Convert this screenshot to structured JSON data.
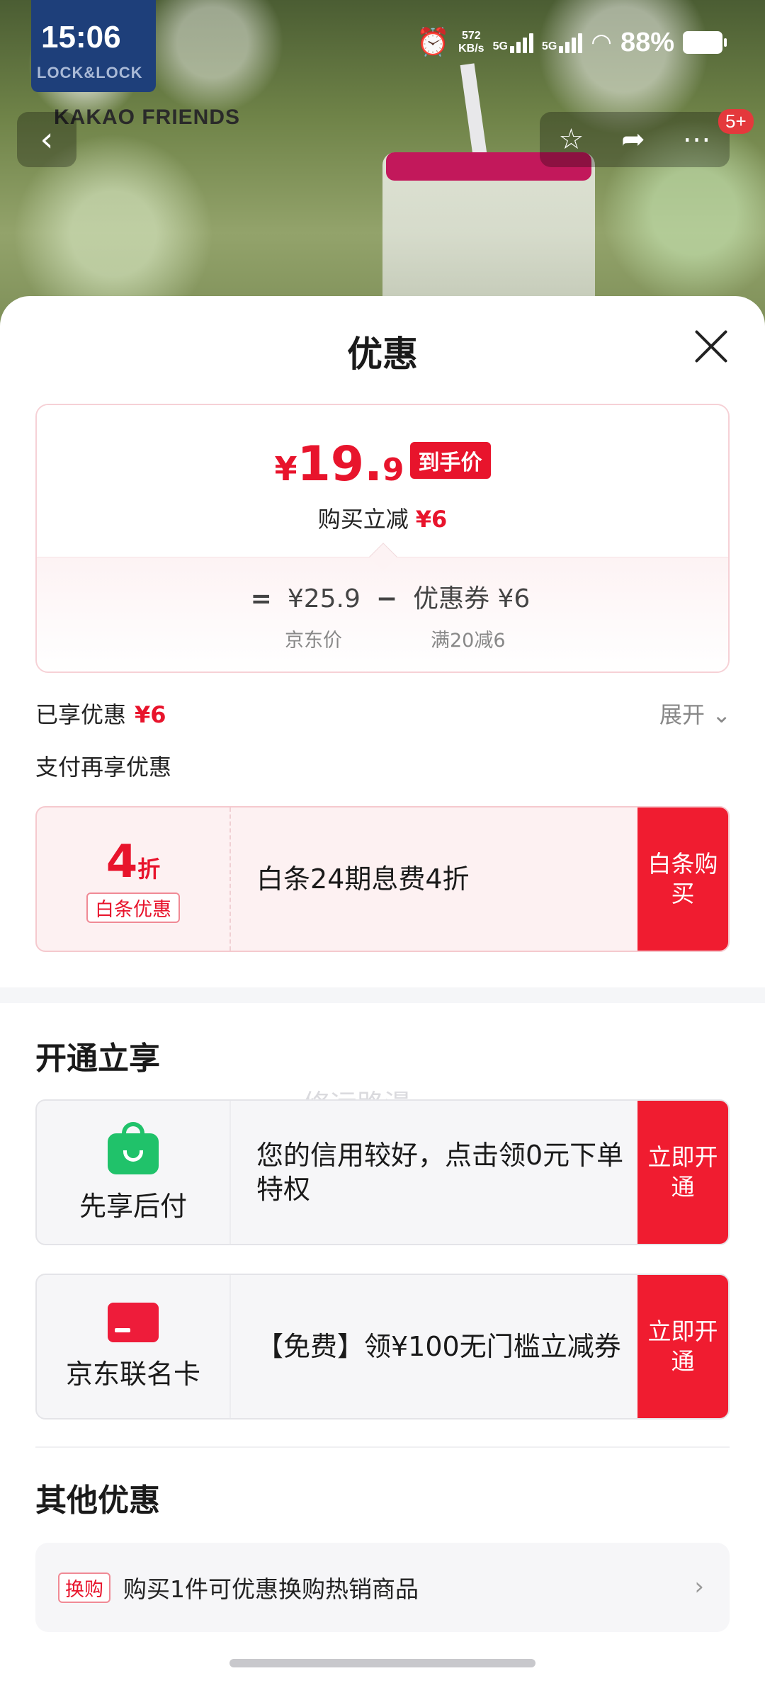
{
  "status_bar": {
    "time": "15:06",
    "net_speed": "572",
    "net_unit": "KB/s",
    "sig1_label": "5G",
    "sig2_label": "5G",
    "battery": "88%"
  },
  "background": {
    "brand_logo": "LOCK&LOCK",
    "brand_kakao": "KAKAO FRIENDS"
  },
  "nav": {
    "back_icon": "chevron-left-icon",
    "star_icon": "star-icon",
    "share_icon": "share-icon",
    "more_icon": "more-icon",
    "badge": "5+"
  },
  "sheet": {
    "title": "优惠",
    "price_card": {
      "currency": "¥",
      "price_int": "19.",
      "price_dec": "9",
      "tag": "到手价",
      "reduce_label": "购买立减",
      "reduce_value": "¥6",
      "equals": "=",
      "jd_price": "¥25.9",
      "minus": "−",
      "coupon_label": "优惠券 ¥6",
      "jd_price_caption": "京东价",
      "coupon_caption": "满20减6"
    },
    "enjoyed_label": "已享优惠",
    "enjoyed_value": "¥6",
    "expand_label": "展开",
    "pay_more_label": "支付再享优惠",
    "watermark": "修远路漫",
    "baitiao": {
      "discount_num": "4",
      "discount_unit": "折",
      "tag": "白条优惠",
      "desc": "白条24期息费4折",
      "button": "白条购买"
    },
    "open_section_title": "开通立享",
    "xianxiang": {
      "label": "先享后付",
      "desc": "您的信用较好，点击领0元下单特权",
      "button": "立即开通"
    },
    "jd_card": {
      "label": "京东联名卡",
      "desc": "【免费】领¥100无门槛立减券",
      "button": "立即开通"
    },
    "other_section_title": "其他优惠",
    "other_row": {
      "tag": "换购",
      "text": "购买1件可优惠换购热销商品"
    }
  },
  "colors": {
    "accent_red": "#e8142c",
    "button_red": "#f01c30",
    "green_icon": "#20c26a"
  }
}
